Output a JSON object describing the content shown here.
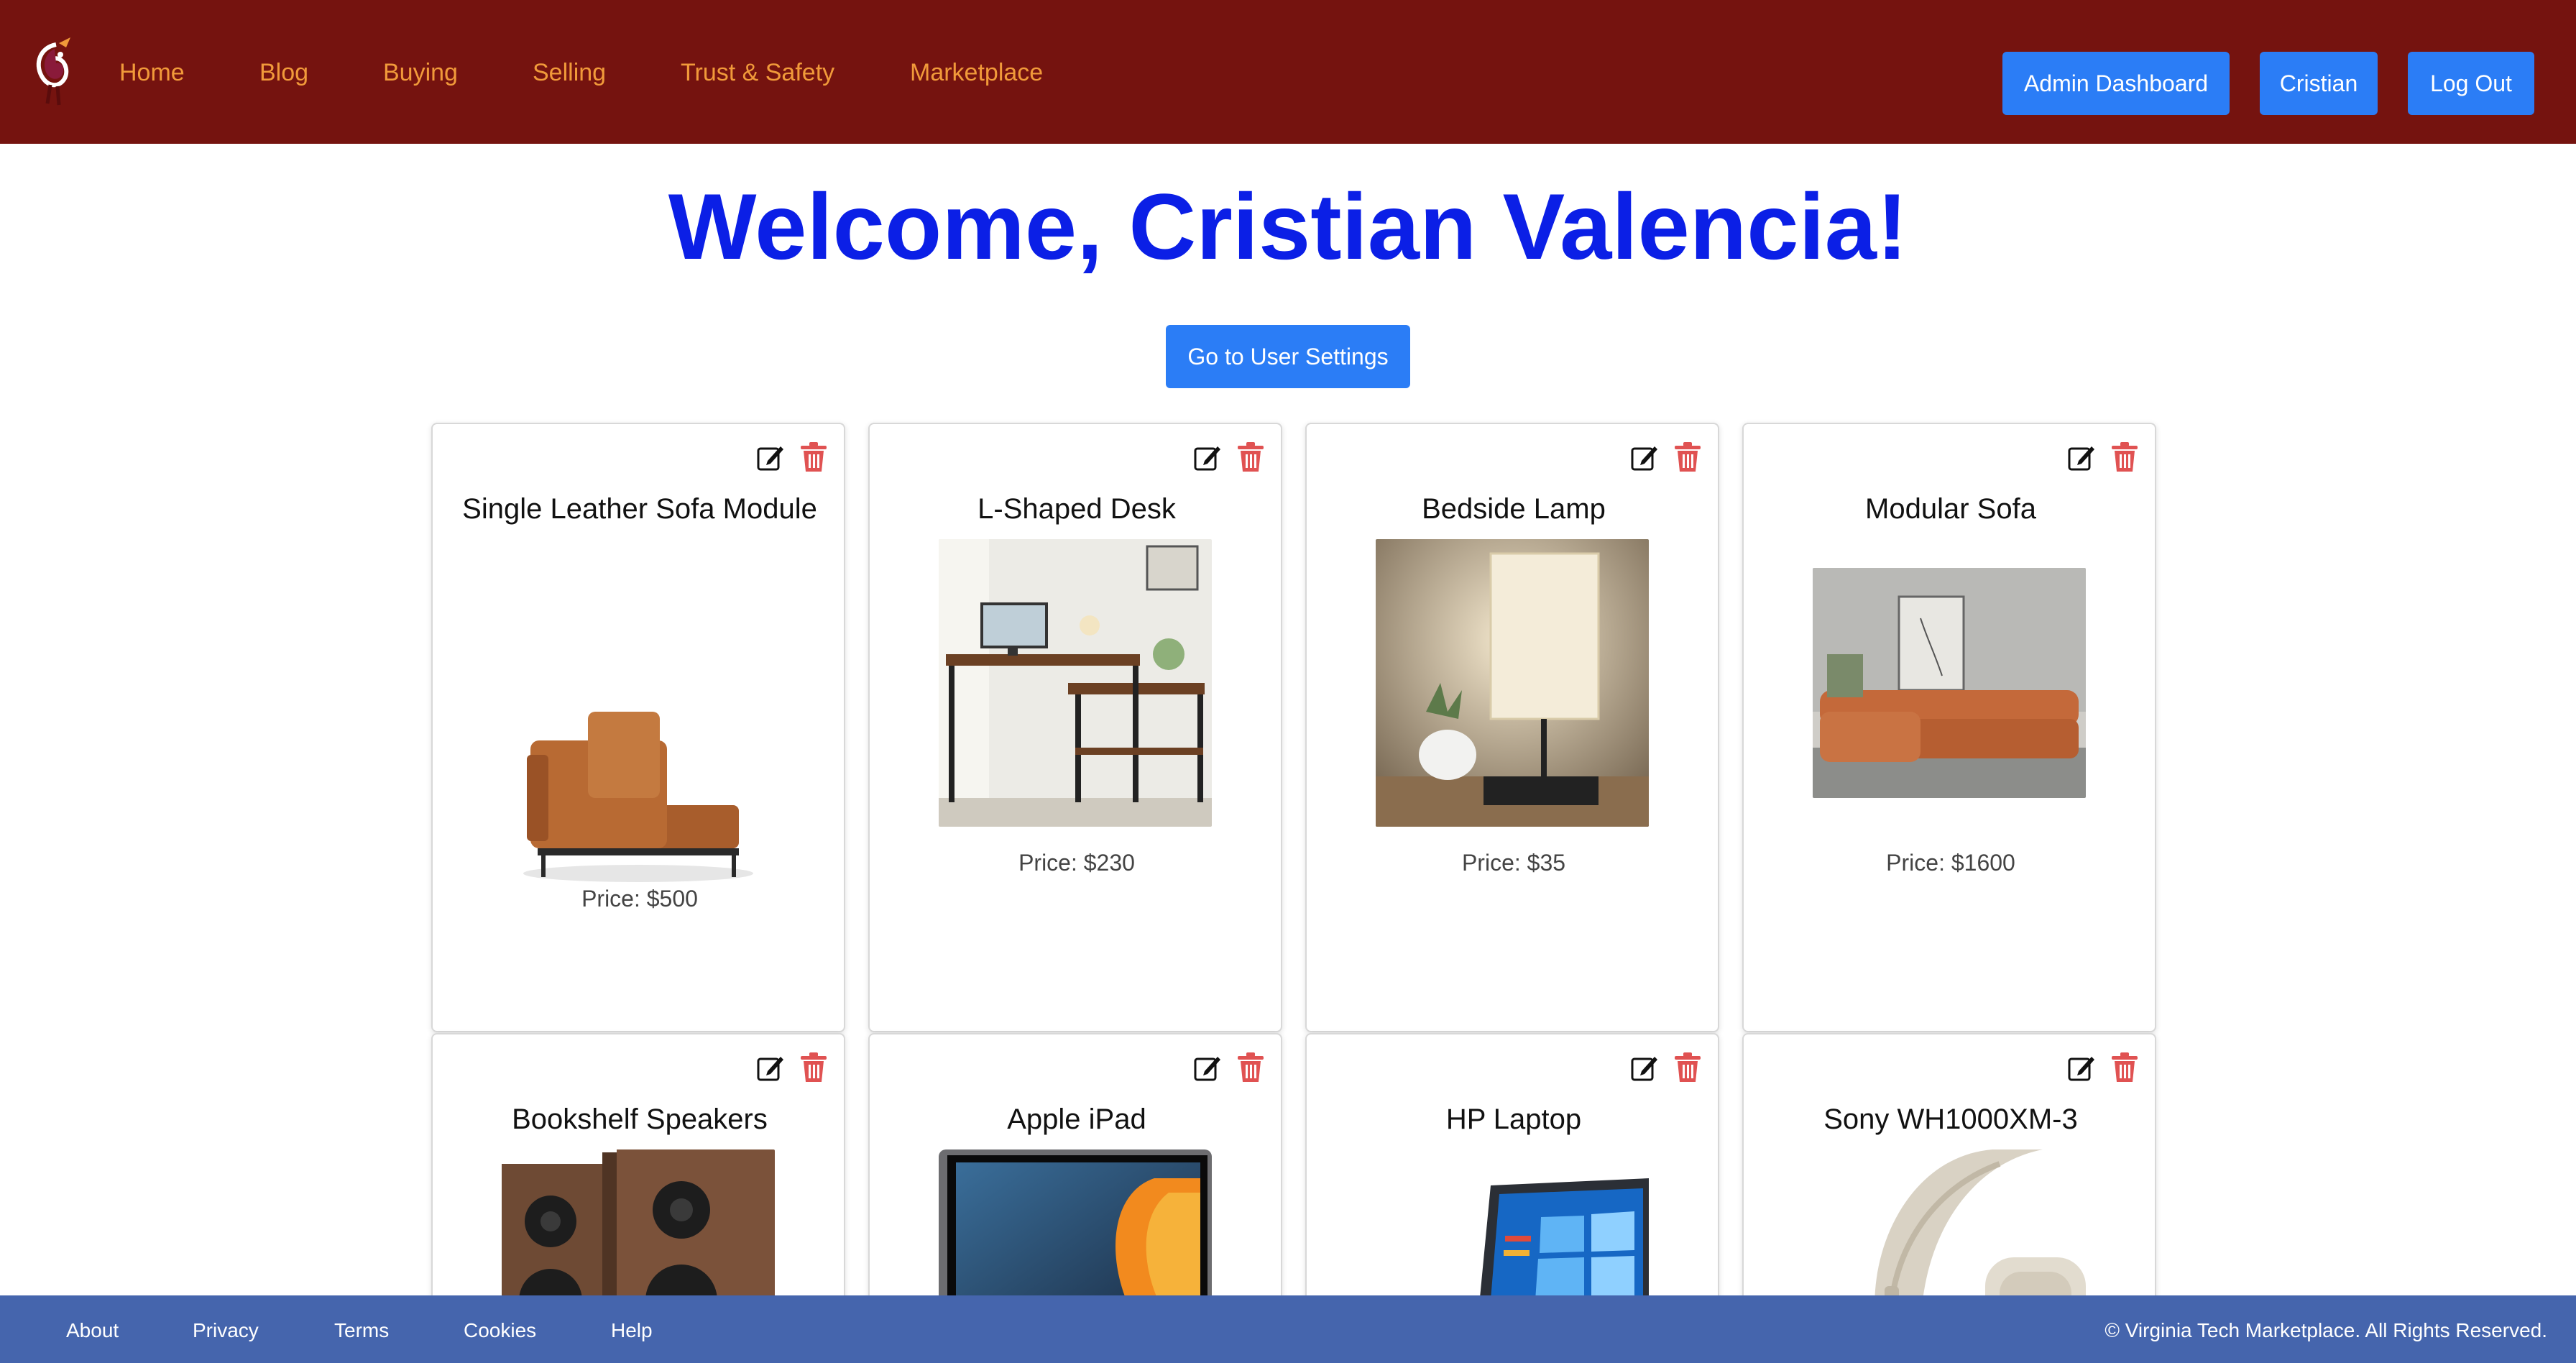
{
  "nav": {
    "links": [
      "Home",
      "Blog",
      "Buying",
      "Selling",
      "Trust & Safety",
      "Marketplace"
    ],
    "admin_button": "Admin Dashboard",
    "user_button": "Cristian",
    "logout_button": "Log Out"
  },
  "main": {
    "welcome": "Welcome, Cristian Valencia!",
    "settings_button": "Go to User Settings"
  },
  "listings": [
    {
      "title": "Single Leather Sofa Module",
      "price": "Price: $500"
    },
    {
      "title": "L-Shaped Desk",
      "price": "Price: $230"
    },
    {
      "title": "Bedside Lamp",
      "price": "Price: $35"
    },
    {
      "title": "Modular Sofa",
      "price": "Price: $1600"
    },
    {
      "title": "Bookshelf Speakers"
    },
    {
      "title": "Apple iPad"
    },
    {
      "title": "HP Laptop"
    },
    {
      "title": "Sony WH1000XM-3"
    }
  ],
  "footer": {
    "links": [
      "About",
      "Privacy",
      "Terms",
      "Cookies",
      "Help"
    ],
    "copyright": "© Virginia Tech Marketplace. All Rights Reserved."
  },
  "colors": {
    "header_bg": "#75130f",
    "nav_link": "#f19a3a",
    "button": "#2b7df6",
    "welcome": "#0b1fe6",
    "footer_bg": "#4565ad",
    "trash_icon": "#e05252"
  },
  "icons": [
    "hokiebird-logo-icon",
    "edit-icon",
    "trash-icon"
  ]
}
